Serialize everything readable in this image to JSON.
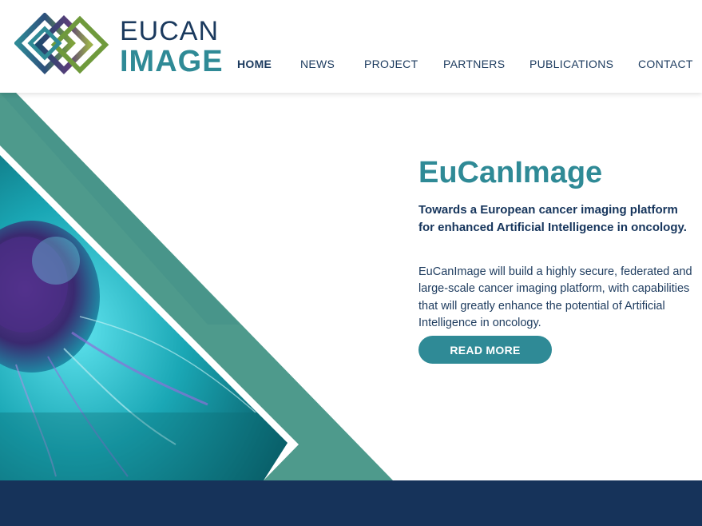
{
  "brand": {
    "line1": "EUCAN",
    "line2": "IMAGE",
    "logo_icon": "interlocking-diamond-icon"
  },
  "nav": {
    "items": [
      {
        "label": "HOME",
        "active": true
      },
      {
        "label": "NEWS",
        "active": false
      },
      {
        "label": "PROJECT",
        "active": false
      },
      {
        "label": "PARTNERS",
        "active": false
      },
      {
        "label": "PUBLICATIONS",
        "active": false
      },
      {
        "label": "CONTACT",
        "active": false
      }
    ]
  },
  "hero": {
    "title": "EuCanImage",
    "subtitle": "Towards a European cancer imaging platform for enhanced Artificial Intelligence in oncology.",
    "description": "EuCanImage will build a highly secure, federated and large-scale cancer imaging platform, with capabilities that will greatly enhance the potential of Artificial Intelligence in oncology.",
    "cta_label": "READ MORE",
    "image": "cancer-cell-microscopy-image"
  },
  "colors": {
    "accent": "#2f8a96",
    "navy": "#16335a",
    "green_band": "#4e9a8c"
  }
}
